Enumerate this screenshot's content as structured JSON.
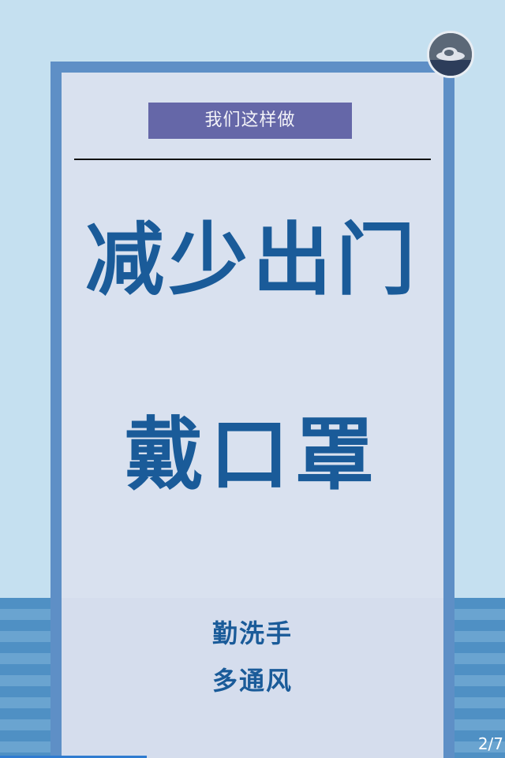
{
  "poster": {
    "header": "我们这样做",
    "headline_1": "减少出门",
    "headline_2": "戴口罩",
    "tip_1": "勤洗手",
    "tip_2": "多通风"
  },
  "viewer": {
    "page_indicator": "2/7",
    "progress_fraction": 0.29,
    "avatar_icon": "user-avatar-icon"
  },
  "colors": {
    "background": "#c5e0f0",
    "frame": "#5e8fc6",
    "card": "#d9e1ef",
    "header_box": "#6567a8",
    "headline_text": "#1a5b99"
  }
}
